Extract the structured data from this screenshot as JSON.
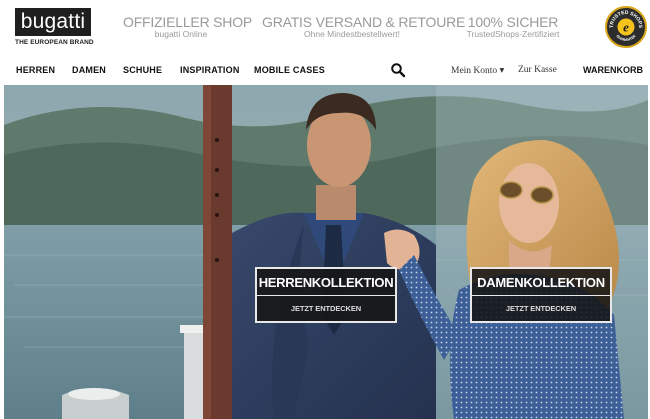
{
  "brand": {
    "logo_text": "bugatti",
    "tagline": "THE EUROPEAN BRAND",
    "dark": "#1f1f1f"
  },
  "promos": {
    "shop": {
      "title": "OFFIZIELLER SHOP",
      "subtitle": "bugatti Online"
    },
    "shipping": {
      "title": "GRATIS VERSAND & RETOURE",
      "subtitle": "Ohne Mindestbestellwert!"
    },
    "secure": {
      "title": "100% SICHER",
      "subtitle": "TrustedShops-Zertifiziert"
    },
    "text_color": "#9a9a9a"
  },
  "trust_badge": {
    "icon": "trusted-shops-seal-icon",
    "ring_text": "TRUSTED SHOPS",
    "bottom_text": "GUARANTEE",
    "center_letter": "e",
    "accent": "#d8a418"
  },
  "nav": {
    "items": [
      {
        "label": "HERREN"
      },
      {
        "label": "DAMEN"
      },
      {
        "label": "SCHUHE"
      },
      {
        "label": "INSPIRATION"
      },
      {
        "label": "MOBILE CASES"
      }
    ],
    "search_icon": "search-icon",
    "account_label": "Mein Konto ▾",
    "checkout_label": "Zur Kasse",
    "cart_label": "WARENKORB"
  },
  "hero": {
    "collections": [
      {
        "title": "HERRENKOLLEKTION",
        "cta": "JETZT ENTDECKEN"
      },
      {
        "title": "DAMENKOLLEKTION",
        "cta": "JETZT ENTDECKEN"
      }
    ],
    "colors": {
      "sea": "#6f8e98",
      "hills": "#4f6a5f",
      "sky": "#9fb6bd",
      "jacket": "#2d3d5e"
    }
  }
}
